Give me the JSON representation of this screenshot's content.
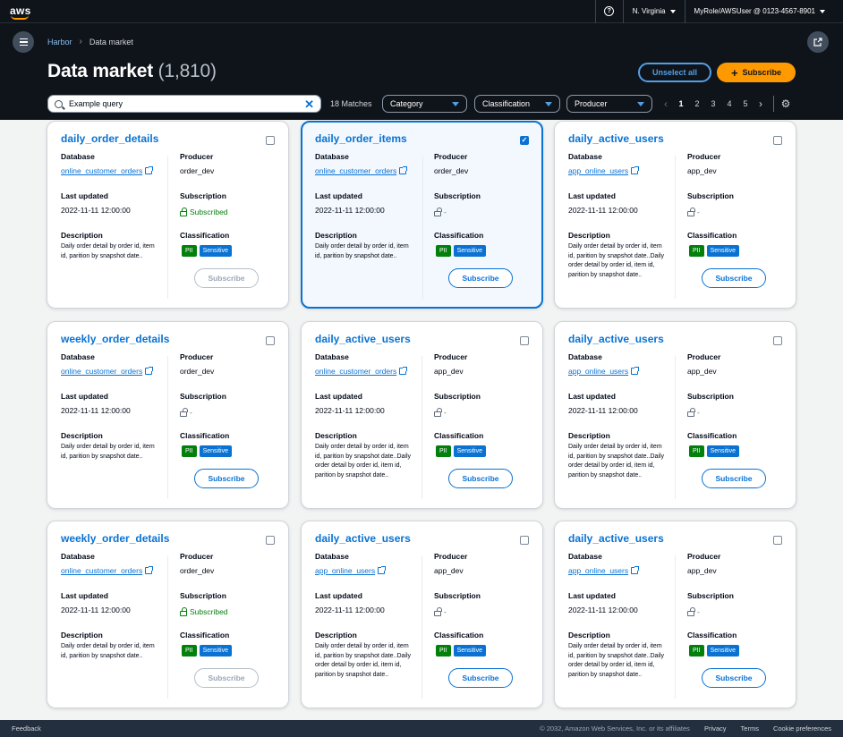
{
  "topnav": {
    "logo": "aws",
    "region": "N. Virginia",
    "account": "MyRole/AWSUser @ 0123-4567-8901"
  },
  "header": {
    "breadcrumb": [
      "Harbor",
      "Data market"
    ],
    "title": "Data market",
    "count": "(1,810)",
    "unselect_label": "Unselect all",
    "subscribe_label": "Subscribe"
  },
  "filters": {
    "search_value": "Example query",
    "matches": "18 Matches",
    "category": "Category",
    "classification": "Classification",
    "producer": "Producer",
    "pages": [
      "1",
      "2",
      "3",
      "4",
      "5"
    ],
    "current_page": "1"
  },
  "labels": {
    "database": "Database",
    "producer": "Producer",
    "last_updated": "Last updated",
    "subscription": "Subscription",
    "description": "Description",
    "classification": "Classification",
    "subscribe": "Subscribe",
    "pii": "PII",
    "sensitive": "Sensitive"
  },
  "cards": [
    {
      "title": "daily_order_details",
      "database": "online_customer_orders",
      "producer": "order_dev",
      "last_updated": "2022-11-11 12:00:00",
      "subscription": "Subscribed",
      "subscribed": true,
      "selected": false,
      "description": "Daily order detail by order id, item id, parition by snapshot date.."
    },
    {
      "title": "daily_order_items",
      "database": "online_customer_orders",
      "producer": "order_dev",
      "last_updated": "2022-11-11 12:00:00",
      "subscription": "-",
      "subscribed": false,
      "selected": true,
      "description": "Daily order detail by order id, item id, parition by snapshot date.."
    },
    {
      "title": "daily_active_users",
      "database": "app_online_users",
      "producer": "app_dev",
      "last_updated": "2022-11-11 12:00:00",
      "subscription": "-",
      "subscribed": false,
      "selected": false,
      "description": "Daily order detail by order id, item id, parition by snapshot date..Daily order detail by order id, item id, parition by snapshot date.."
    },
    {
      "title": "weekly_order_details",
      "database": "online_customer_orders",
      "producer": "order_dev",
      "last_updated": "2022-11-11 12:00:00",
      "subscription": "-",
      "subscribed": false,
      "selected": false,
      "description": "Daily order detail by order id, item id, parition by snapshot date.."
    },
    {
      "title": "daily_active_users",
      "database": "online_customer_orders",
      "producer": "app_dev",
      "last_updated": "2022-11-11 12:00:00",
      "subscription": "-",
      "subscribed": false,
      "selected": false,
      "description": "Daily order detail by order id, item id, parition by snapshot date..Daily order detail by order id, item id, parition by snapshot date.."
    },
    {
      "title": "daily_active_users",
      "database": "app_online_users",
      "producer": "app_dev",
      "last_updated": "2022-11-11 12:00:00",
      "subscription": "-",
      "subscribed": false,
      "selected": false,
      "description": "Daily order detail by order id, item id, parition by snapshot date..Daily order detail by order id, item id, parition by snapshot date.."
    },
    {
      "title": "weekly_order_details",
      "database": "online_customer_orders",
      "producer": "order_dev",
      "last_updated": "2022-11-11 12:00:00",
      "subscription": "Subscribed",
      "subscribed": true,
      "selected": false,
      "description": "Daily order detail by order id, item id, parition by snapshot date.."
    },
    {
      "title": "daily_active_users",
      "database": "app_online_users",
      "producer": "app_dev",
      "last_updated": "2022-11-11 12:00:00",
      "subscription": "-",
      "subscribed": false,
      "selected": false,
      "description": "Daily order detail by order id, item id, parition by snapshot date..Daily order detail by order id, item id, parition by snapshot date.."
    },
    {
      "title": "daily_active_users",
      "database": "app_online_users",
      "producer": "app_dev",
      "last_updated": "2022-11-11 12:00:00",
      "subscription": "-",
      "subscribed": false,
      "selected": false,
      "description": "Daily order detail by order id, item id, parition by snapshot date..Daily order detail by order id, item id, parition by snapshot date.."
    }
  ],
  "footer": {
    "feedback": "Feedback",
    "copyright": "© 2032, Amazon Web Services, Inc. or its affiliates",
    "privacy": "Privacy",
    "terms": "Terms",
    "cookies": "Cookie preferences"
  },
  "colors": {
    "accent": "#0972d3",
    "orange": "#ff9900",
    "nav_bg": "#0f141a",
    "success": "#037f0c"
  }
}
